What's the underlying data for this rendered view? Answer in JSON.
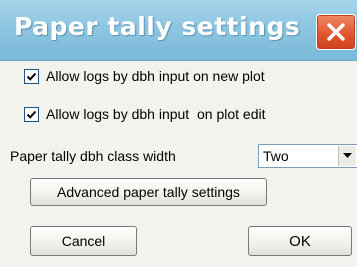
{
  "window": {
    "title": "Paper tally settings"
  },
  "options": {
    "allow_new_plot": {
      "label": "Allow logs by dbh input on new plot",
      "checked": true
    },
    "allow_plot_edit": {
      "label": "Allow logs by dbh input  on plot edit",
      "checked": true
    }
  },
  "dbh_class": {
    "label": "Paper tally dbh class width",
    "selected": "Two"
  },
  "buttons": {
    "advanced": "Advanced paper tally settings",
    "cancel": "Cancel",
    "ok": "OK"
  },
  "icons": {
    "close": "close-icon",
    "check": "checkmark-icon",
    "dropdown": "chevron-down-icon"
  },
  "colors": {
    "titlebar": "#8dc6e1",
    "close_button": "#e2572f",
    "dialog_background": "#f3f3ee"
  }
}
